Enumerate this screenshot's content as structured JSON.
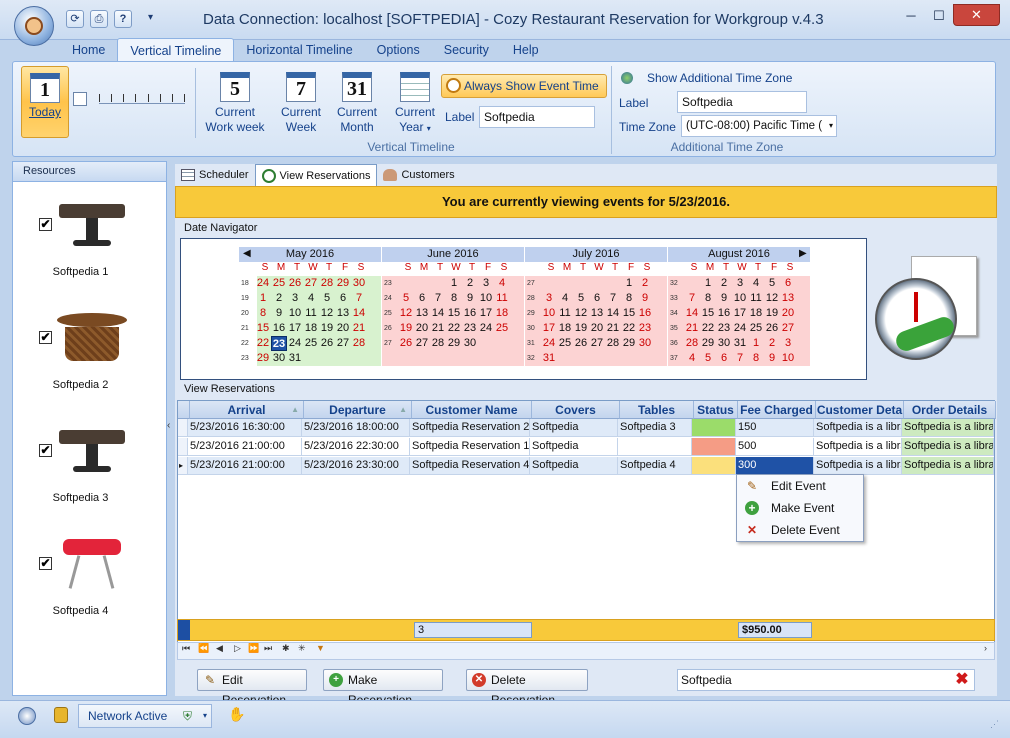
{
  "window": {
    "title": "Data Connection: localhost [SOFTPEDIA] - Cozy Restaurant Reservation for Workgroup v.4.3",
    "qat": [
      "refresh-icon",
      "print-icon",
      "help-icon"
    ]
  },
  "ribbon_tabs": [
    "Home",
    "Vertical Timeline",
    "Horizontal Timeline",
    "Options",
    "Security",
    "Help"
  ],
  "ribbon_tabs_active": "Vertical Timeline",
  "ribbon": {
    "today_num": "1",
    "today_label": "Today",
    "buttons": [
      {
        "num": "5",
        "line1": "Current",
        "line2": "Work week"
      },
      {
        "num": "7",
        "line1": "Current",
        "line2": "Week"
      },
      {
        "num": "31",
        "line1": "Current",
        "line2": "Month"
      },
      {
        "num": "",
        "line1": "Current",
        "line2": "Year"
      }
    ],
    "always_show": "Always Show Event Time",
    "label_caption": "Label",
    "label_value": "Softpedia",
    "group_vertical": "Vertical Timeline",
    "show_additional": "Show Additional Time Zone",
    "label2_caption": "Label",
    "label2_value": "Softpedia",
    "timezone_caption": "Time Zone",
    "timezone_value": "(UTC-08:00) Pacific Time (",
    "group_additional": "Additional Time Zone"
  },
  "resources": {
    "header": "Resources",
    "items": [
      {
        "name": "Softpedia 1",
        "checked": "✔"
      },
      {
        "name": "Softpedia 2",
        "checked": "✔"
      },
      {
        "name": "Softpedia 3",
        "checked": "✔"
      },
      {
        "name": "Softpedia 4",
        "checked": "✔"
      }
    ]
  },
  "view_tabs": [
    "Scheduler",
    "View Reservations",
    "Customers"
  ],
  "view_tabs_active": "View Reservations",
  "banner": "You are currently viewing events for 5/23/2016.",
  "date_navigator_label": "Date Navigator",
  "calendar": {
    "dow": [
      "S",
      "M",
      "T",
      "W",
      "T",
      "F",
      "S"
    ],
    "months": [
      {
        "name": "May 2016",
        "bg": "5",
        "weeks": [
          {
            "wk": "18",
            "days": [
              "24",
              "25",
              "26",
              "27",
              "28",
              "29",
              "30"
            ]
          },
          {
            "wk": "19",
            "days": [
              "1",
              "2",
              "3",
              "4",
              "5",
              "6",
              "7"
            ]
          },
          {
            "wk": "20",
            "days": [
              "8",
              "9",
              "10",
              "11",
              "12",
              "13",
              "14"
            ]
          },
          {
            "wk": "21",
            "days": [
              "15",
              "16",
              "17",
              "18",
              "19",
              "20",
              "21"
            ]
          },
          {
            "wk": "22",
            "days": [
              "22",
              "23",
              "24",
              "25",
              "26",
              "27",
              "28"
            ]
          },
          {
            "wk": "23",
            "days": [
              "29",
              "30",
              "31",
              "",
              "",
              "",
              ""
            ]
          }
        ]
      },
      {
        "name": "June 2016",
        "bg": "6",
        "weeks": [
          {
            "wk": "23",
            "days": [
              "",
              "",
              "",
              "1",
              "2",
              "3",
              "4"
            ]
          },
          {
            "wk": "24",
            "days": [
              "5",
              "6",
              "7",
              "8",
              "9",
              "10",
              "11"
            ]
          },
          {
            "wk": "25",
            "days": [
              "12",
              "13",
              "14",
              "15",
              "16",
              "17",
              "18"
            ]
          },
          {
            "wk": "26",
            "days": [
              "19",
              "20",
              "21",
              "22",
              "23",
              "24",
              "25"
            ]
          },
          {
            "wk": "27",
            "days": [
              "26",
              "27",
              "28",
              "29",
              "30",
              "",
              ""
            ]
          },
          {
            "wk": "",
            "days": [
              "",
              "",
              "",
              "",
              "",
              "",
              ""
            ]
          }
        ]
      },
      {
        "name": "July 2016",
        "bg": "7",
        "weeks": [
          {
            "wk": "27",
            "days": [
              "",
              "",
              "",
              "",
              "",
              "1",
              "2"
            ]
          },
          {
            "wk": "28",
            "days": [
              "3",
              "4",
              "5",
              "6",
              "7",
              "8",
              "9"
            ]
          },
          {
            "wk": "29",
            "days": [
              "10",
              "11",
              "12",
              "13",
              "14",
              "15",
              "16"
            ]
          },
          {
            "wk": "30",
            "days": [
              "17",
              "18",
              "19",
              "20",
              "21",
              "22",
              "23"
            ]
          },
          {
            "wk": "31",
            "days": [
              "24",
              "25",
              "26",
              "27",
              "28",
              "29",
              "30"
            ]
          },
          {
            "wk": "32",
            "days": [
              "31",
              "",
              "",
              "",
              "",
              "",
              ""
            ]
          }
        ]
      },
      {
        "name": "August 2016",
        "bg": "8",
        "weeks": [
          {
            "wk": "32",
            "days": [
              "",
              "1",
              "2",
              "3",
              "4",
              "5",
              "6"
            ]
          },
          {
            "wk": "33",
            "days": [
              "7",
              "8",
              "9",
              "10",
              "11",
              "12",
              "13"
            ]
          },
          {
            "wk": "34",
            "days": [
              "14",
              "15",
              "16",
              "17",
              "18",
              "19",
              "20"
            ]
          },
          {
            "wk": "35",
            "days": [
              "21",
              "22",
              "23",
              "24",
              "25",
              "26",
              "27"
            ]
          },
          {
            "wk": "36",
            "days": [
              "28",
              "29",
              "30",
              "31",
              "1",
              "2",
              "3"
            ]
          },
          {
            "wk": "37",
            "days": [
              "4",
              "5",
              "6",
              "7",
              "8",
              "9",
              "10"
            ]
          }
        ]
      }
    ]
  },
  "view_reservations_label": "View Reservations",
  "grid": {
    "columns": [
      "Arrival",
      "Departure",
      "Customer Name",
      "Covers",
      "Tables",
      "Status",
      "Fee Charged",
      "Customer Deta",
      "Order Details"
    ],
    "rows": [
      {
        "arrival": "5/23/2016 16:30:00",
        "departure": "5/23/2016 18:00:00",
        "customer": "Softpedia Reservation 2",
        "covers": "Softpedia",
        "tables": "Softpedia 3",
        "status_color": "#9bdc6a",
        "fee": "150",
        "cust_details": "Softpedia is a libra",
        "order_details": "Softpedia is a libra"
      },
      {
        "arrival": "5/23/2016 21:00:00",
        "departure": "5/23/2016 22:30:00",
        "customer": "Softpedia Reservation 1",
        "covers": "Softpedia",
        "tables": "",
        "status_color": "#f59c85",
        "fee": "500",
        "cust_details": "Softpedia is a libra",
        "order_details": "Softpedia is a libra"
      },
      {
        "arrival": "5/23/2016 21:00:00",
        "departure": "5/23/2016 23:30:00",
        "customer": "Softpedia Reservation 4",
        "covers": "Softpedia",
        "tables": "Softpedia 4",
        "status_color": "#fbe07c",
        "fee": "300",
        "cust_details": "Softpedia is a libra",
        "order_details": "Softpedia is a libra"
      }
    ],
    "footer_count": "3",
    "footer_fee": "$950.00"
  },
  "context_menu": [
    "Edit Event",
    "Make Event",
    "Delete Event"
  ],
  "bottom": {
    "edit": "Edit Reservation",
    "make": "Make Reservation",
    "delete": "Delete Reservation",
    "search_value": "Softpedia"
  },
  "status": {
    "network": "Network Active"
  }
}
